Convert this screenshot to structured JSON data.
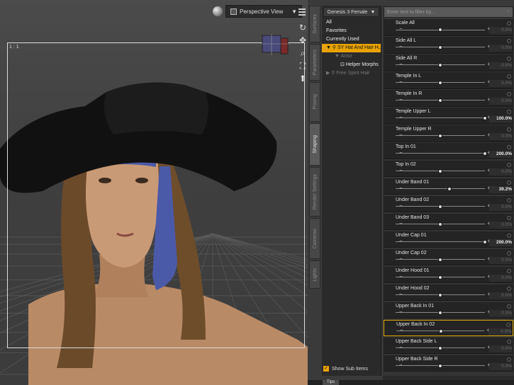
{
  "viewport": {
    "camera_label": "Perspective View",
    "frame_label": "1 : 1"
  },
  "side_tabs": [
    {
      "label": "Surfaces",
      "active": false
    },
    {
      "label": "Parameters",
      "active": false
    },
    {
      "label": "Posing",
      "active": false
    },
    {
      "label": "Shaping",
      "active": true
    },
    {
      "label": "Render Settings",
      "active": false
    },
    {
      "label": "Cameras",
      "active": false
    },
    {
      "label": "Lights",
      "active": false
    }
  ],
  "list_panel": {
    "figure_dropdown": "Genesis 3 Female",
    "items": [
      {
        "label": "All",
        "state": "normal"
      },
      {
        "label": "Favorites",
        "state": "normal"
      },
      {
        "label": "Currently Used",
        "state": "normal"
      },
      {
        "label": "SY Hat And Hair H...",
        "state": "selected"
      },
      {
        "label": "Actor",
        "state": "dim"
      },
      {
        "label": "Helper Morphs",
        "state": "normal"
      },
      {
        "label": "Free Spirit Hair",
        "state": "dim"
      }
    ],
    "show_sub_items": "Show Sub Items"
  },
  "property_panel": {
    "filter_placeholder": "Enter text to filter by...",
    "sliders": [
      {
        "label": "Scale All",
        "value": "0.0%",
        "position": 0.5
      },
      {
        "label": "Side All L",
        "value": "0.0%",
        "position": 0.5
      },
      {
        "label": "Side All R",
        "value": "0.0%",
        "position": 0.5
      },
      {
        "label": "Temple In L",
        "value": "0.0%",
        "position": 0.5
      },
      {
        "label": "Temple In R",
        "value": "0.0%",
        "position": 0.5
      },
      {
        "label": "Temple Upper L",
        "value": "100.0%",
        "position": 1.0
      },
      {
        "label": "Temple Upper R",
        "value": "0.0%",
        "position": 0.5
      },
      {
        "label": "Top In 01",
        "value": "200.0%",
        "position": 1.0
      },
      {
        "label": "Top In 02",
        "value": "0.0%",
        "position": 0.5
      },
      {
        "label": "Under Band 01",
        "value": "39.2%",
        "position": 0.6
      },
      {
        "label": "Under Band 02",
        "value": "0.0%",
        "position": 0.5
      },
      {
        "label": "Under Band 03",
        "value": "0.0%",
        "position": 0.5
      },
      {
        "label": "Under Cap 01",
        "value": "200.0%",
        "position": 1.0
      },
      {
        "label": "Under Cap 02",
        "value": "0.0%",
        "position": 0.5
      },
      {
        "label": "Under Hood 01",
        "value": "0.0%",
        "position": 0.5
      },
      {
        "label": "Under Hood 02",
        "value": "0.0%",
        "position": 0.5
      },
      {
        "label": "Upper Back In 01",
        "value": "0.0%",
        "position": 0.5
      },
      {
        "label": "Upper Back In 02",
        "value": "0.0%",
        "position": 0.5
      },
      {
        "label": "Upper Back Side L",
        "value": "0.0%",
        "position": 0.5
      },
      {
        "label": "Upper Back Side R",
        "value": "0.0%",
        "position": 0.5
      }
    ],
    "highlighted_index": 17
  },
  "bottom": {
    "tips_tab": "Tips"
  },
  "colors": {
    "accent": "#e8a300",
    "panel_bg": "#343434",
    "slider_bg": "#242424",
    "headband": "#4b5aa8"
  }
}
